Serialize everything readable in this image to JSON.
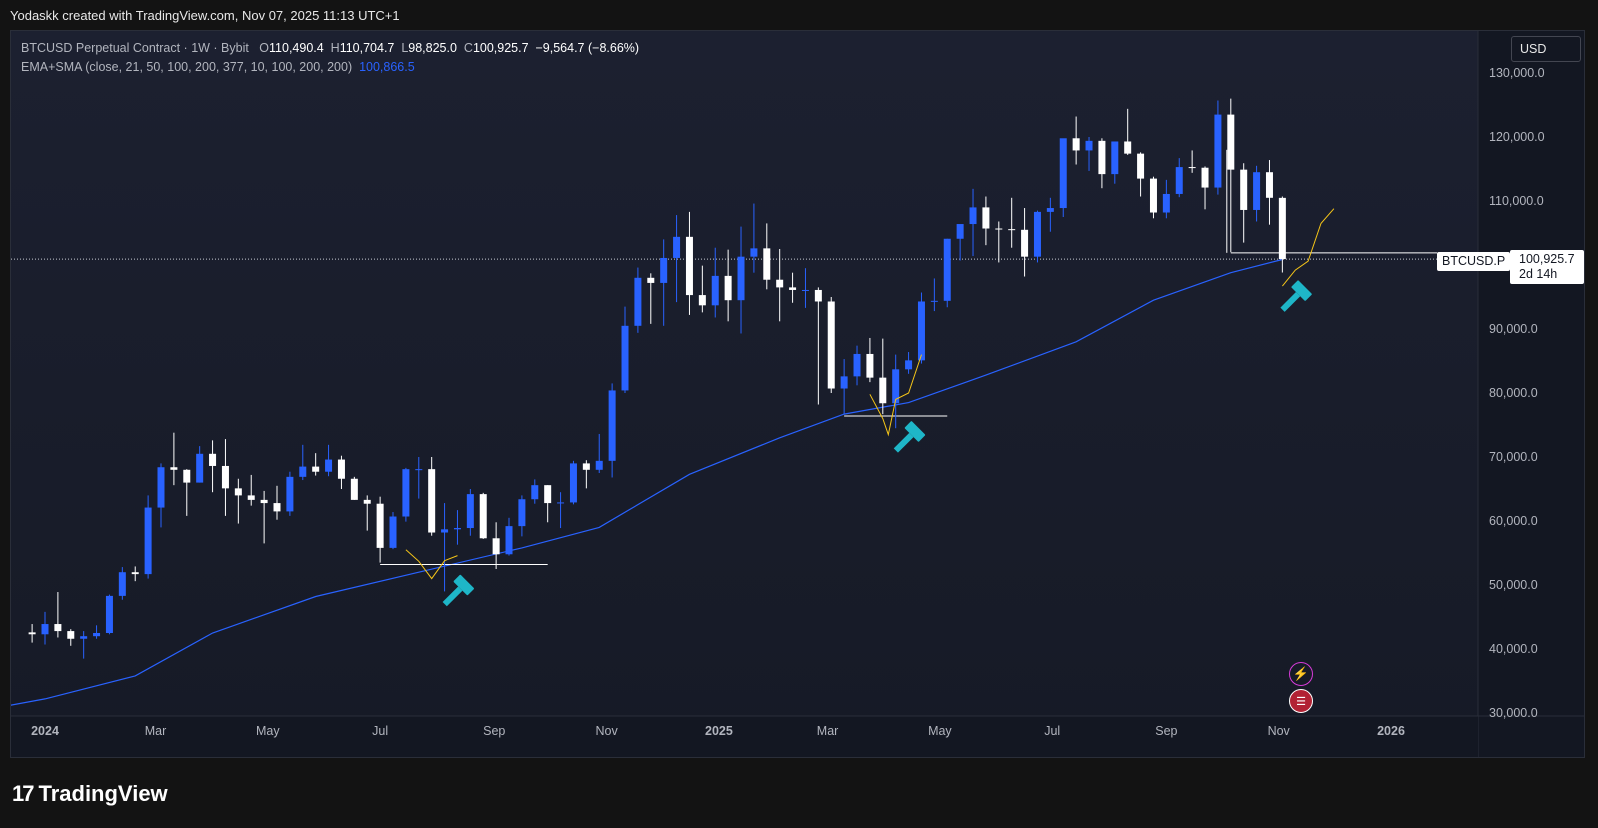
{
  "header": {
    "credit": "Yodaskk created with TradingView.com, Nov 07, 2025 11:13 UTC+1"
  },
  "legend": {
    "symbol": "BTCUSD Perpetual Contract · 1W · Bybit",
    "open_label": "O",
    "open": "110,490.4",
    "high_label": "H",
    "high": "110,704.7",
    "low_label": "L",
    "low": "98,825.0",
    "close_label": "C",
    "close": "100,925.7",
    "change": "−9,564.7 (−8.66%)",
    "indicator": "EMA+SMA (close, 21, 50, 100, 200, 377, 10, 100, 200, 200)",
    "indicator_value": "100,866.5"
  },
  "currency": "USD",
  "price_tag": {
    "ticker": "BTCUSD.P",
    "price": "100,925.7",
    "countdown": "2d 14h"
  },
  "footer": {
    "brand": "TradingView",
    "brand_mark": "17"
  },
  "colors": {
    "up_candle": "#2962ff",
    "down_candle": "#ffffff",
    "ema_line": "#2962ff",
    "projection": "#f5c518",
    "hammer_icon": "#1eb6c8",
    "background_top": "#1c2030",
    "background_bottom": "#161a26"
  },
  "icons": [
    "hammer-icon",
    "lightning-icon",
    "us-flag-icon"
  ],
  "chart_data": {
    "type": "candlestick",
    "interval": "1W",
    "ylim": [
      30000,
      130000
    ],
    "y_ticks": [
      "130,000.0",
      "120,000.0",
      "110,000.0",
      "100,000.0",
      "90,000.0",
      "80,000.0",
      "70,000.0",
      "60,000.0",
      "50,000.0",
      "40,000.0",
      "30,000.0"
    ],
    "y_tick_values": [
      130000,
      120000,
      110000,
      100000,
      90000,
      80000,
      70000,
      60000,
      50000,
      40000,
      30000
    ],
    "x_ticks": [
      "2024",
      "Mar",
      "May",
      "Jul",
      "Sep",
      "Nov",
      "2025",
      "Mar",
      "May",
      "Jul",
      "Sep",
      "Nov",
      "2026"
    ],
    "x_tick_dates": [
      "2024-01-01",
      "2024-03-01",
      "2024-05-01",
      "2024-07-01",
      "2024-09-01",
      "2024-11-01",
      "2025-01-01",
      "2025-03-01",
      "2025-05-01",
      "2025-07-01",
      "2025-09-01",
      "2025-11-01",
      "2026-01-01"
    ],
    "last_price": 100925.7,
    "candles": [
      {
        "d": "2023-12-25",
        "o": 42600,
        "h": 43900,
        "l": 41000,
        "c": 42300
      },
      {
        "d": "2024-01-01",
        "o": 42300,
        "h": 45800,
        "l": 40700,
        "c": 43900
      },
      {
        "d": "2024-01-08",
        "o": 43900,
        "h": 48900,
        "l": 41800,
        "c": 42800
      },
      {
        "d": "2024-01-15",
        "o": 42800,
        "h": 43100,
        "l": 40500,
        "c": 41600
      },
      {
        "d": "2024-01-22",
        "o": 41600,
        "h": 42800,
        "l": 38500,
        "c": 42000
      },
      {
        "d": "2024-01-29",
        "o": 42000,
        "h": 43700,
        "l": 41600,
        "c": 42500
      },
      {
        "d": "2024-02-05",
        "o": 42500,
        "h": 48500,
        "l": 42300,
        "c": 48300
      },
      {
        "d": "2024-02-12",
        "o": 48300,
        "h": 52800,
        "l": 47700,
        "c": 52000
      },
      {
        "d": "2024-02-19",
        "o": 52000,
        "h": 52900,
        "l": 50600,
        "c": 51700
      },
      {
        "d": "2024-02-26",
        "o": 51700,
        "h": 64000,
        "l": 51000,
        "c": 62100
      },
      {
        "d": "2024-03-04",
        "o": 62100,
        "h": 69000,
        "l": 59000,
        "c": 68400
      },
      {
        "d": "2024-03-11",
        "o": 68400,
        "h": 73800,
        "l": 65600,
        "c": 68000
      },
      {
        "d": "2024-03-18",
        "o": 68000,
        "h": 68100,
        "l": 60800,
        "c": 66000
      },
      {
        "d": "2024-03-25",
        "o": 66000,
        "h": 71700,
        "l": 66000,
        "c": 70500
      },
      {
        "d": "2024-04-01",
        "o": 70500,
        "h": 72600,
        "l": 64500,
        "c": 68600
      },
      {
        "d": "2024-04-08",
        "o": 68600,
        "h": 72800,
        "l": 60800,
        "c": 65100
      },
      {
        "d": "2024-04-15",
        "o": 65100,
        "h": 66600,
        "l": 59600,
        "c": 64000
      },
      {
        "d": "2024-04-22",
        "o": 64000,
        "h": 67200,
        "l": 62400,
        "c": 63300
      },
      {
        "d": "2024-04-29",
        "o": 63300,
        "h": 64700,
        "l": 56500,
        "c": 62800
      },
      {
        "d": "2024-05-06",
        "o": 62800,
        "h": 65500,
        "l": 60200,
        "c": 61500
      },
      {
        "d": "2024-05-13",
        "o": 61500,
        "h": 67700,
        "l": 60800,
        "c": 66900
      },
      {
        "d": "2024-05-20",
        "o": 66900,
        "h": 71900,
        "l": 66400,
        "c": 68500
      },
      {
        "d": "2024-05-27",
        "o": 68500,
        "h": 70600,
        "l": 67100,
        "c": 67700
      },
      {
        "d": "2024-06-03",
        "o": 67700,
        "h": 71900,
        "l": 67000,
        "c": 69600
      },
      {
        "d": "2024-06-10",
        "o": 69600,
        "h": 70200,
        "l": 65000,
        "c": 66600
      },
      {
        "d": "2024-06-17",
        "o": 66600,
        "h": 66900,
        "l": 63300,
        "c": 63300
      },
      {
        "d": "2024-06-24",
        "o": 63300,
        "h": 64000,
        "l": 58500,
        "c": 62700
      },
      {
        "d": "2024-07-01",
        "o": 62700,
        "h": 63800,
        "l": 53500,
        "c": 55800
      },
      {
        "d": "2024-07-08",
        "o": 55800,
        "h": 61400,
        "l": 55600,
        "c": 60700
      },
      {
        "d": "2024-07-15",
        "o": 60700,
        "h": 68300,
        "l": 59900,
        "c": 68100
      },
      {
        "d": "2024-07-22",
        "o": 68100,
        "h": 70000,
        "l": 63500,
        "c": 68100
      },
      {
        "d": "2024-07-29",
        "o": 68100,
        "h": 70000,
        "l": 57700,
        "c": 58200
      },
      {
        "d": "2024-08-05",
        "o": 58200,
        "h": 62800,
        "l": 49000,
        "c": 58700
      },
      {
        "d": "2024-08-12",
        "o": 58700,
        "h": 61700,
        "l": 56300,
        "c": 58900
      },
      {
        "d": "2024-08-19",
        "o": 58900,
        "h": 65000,
        "l": 57700,
        "c": 64200
      },
      {
        "d": "2024-08-26",
        "o": 64200,
        "h": 64400,
        "l": 57200,
        "c": 57300
      },
      {
        "d": "2024-09-02",
        "o": 57300,
        "h": 59800,
        "l": 52500,
        "c": 54800
      },
      {
        "d": "2024-09-09",
        "o": 54800,
        "h": 60500,
        "l": 54600,
        "c": 59200
      },
      {
        "d": "2024-09-16",
        "o": 59200,
        "h": 64000,
        "l": 57600,
        "c": 63400
      },
      {
        "d": "2024-09-23",
        "o": 63400,
        "h": 66500,
        "l": 62700,
        "c": 65600
      },
      {
        "d": "2024-09-30",
        "o": 65600,
        "h": 65600,
        "l": 59800,
        "c": 62800
      },
      {
        "d": "2024-10-07",
        "o": 62800,
        "h": 64500,
        "l": 58900,
        "c": 62900
      },
      {
        "d": "2024-10-14",
        "o": 62900,
        "h": 69400,
        "l": 62600,
        "c": 69000
      },
      {
        "d": "2024-10-21",
        "o": 69000,
        "h": 69500,
        "l": 65100,
        "c": 68000
      },
      {
        "d": "2024-10-28",
        "o": 68000,
        "h": 73600,
        "l": 67500,
        "c": 69400
      },
      {
        "d": "2024-11-04",
        "o": 69400,
        "h": 81500,
        "l": 66800,
        "c": 80400
      },
      {
        "d": "2024-11-11",
        "o": 80400,
        "h": 93500,
        "l": 80000,
        "c": 90500
      },
      {
        "d": "2024-11-18",
        "o": 90500,
        "h": 99600,
        "l": 89400,
        "c": 98000
      },
      {
        "d": "2024-11-25",
        "o": 98000,
        "h": 98700,
        "l": 90800,
        "c": 97200
      },
      {
        "d": "2024-12-02",
        "o": 97200,
        "h": 104000,
        "l": 90500,
        "c": 101100
      },
      {
        "d": "2024-12-09",
        "o": 101100,
        "h": 107800,
        "l": 94200,
        "c": 104400
      },
      {
        "d": "2024-12-16",
        "o": 104400,
        "h": 108300,
        "l": 92200,
        "c": 95300
      },
      {
        "d": "2024-12-23",
        "o": 95300,
        "h": 99900,
        "l": 92600,
        "c": 93700
      },
      {
        "d": "2024-12-30",
        "o": 93700,
        "h": 102700,
        "l": 91800,
        "c": 98300
      },
      {
        "d": "2025-01-06",
        "o": 98300,
        "h": 102400,
        "l": 91200,
        "c": 94500
      },
      {
        "d": "2025-01-13",
        "o": 94500,
        "h": 106000,
        "l": 89300,
        "c": 101300
      },
      {
        "d": "2025-01-20",
        "o": 101300,
        "h": 109600,
        "l": 98800,
        "c": 102600
      },
      {
        "d": "2025-01-27",
        "o": 102600,
        "h": 106500,
        "l": 96200,
        "c": 97700
      },
      {
        "d": "2025-02-03",
        "o": 97700,
        "h": 102500,
        "l": 91200,
        "c": 96500
      },
      {
        "d": "2025-02-10",
        "o": 96500,
        "h": 98800,
        "l": 94100,
        "c": 96100
      },
      {
        "d": "2025-02-17",
        "o": 96100,
        "h": 99500,
        "l": 93300,
        "c": 96100
      },
      {
        "d": "2025-02-24",
        "o": 96100,
        "h": 96500,
        "l": 78200,
        "c": 94300
      },
      {
        "d": "2025-03-03",
        "o": 94300,
        "h": 95000,
        "l": 80000,
        "c": 80700
      },
      {
        "d": "2025-03-10",
        "o": 80700,
        "h": 85300,
        "l": 76700,
        "c": 82600
      },
      {
        "d": "2025-03-17",
        "o": 82600,
        "h": 87400,
        "l": 81200,
        "c": 86100
      },
      {
        "d": "2025-03-24",
        "o": 86100,
        "h": 88600,
        "l": 81700,
        "c": 82400
      },
      {
        "d": "2025-03-31",
        "o": 82400,
        "h": 88500,
        "l": 76700,
        "c": 78400
      },
      {
        "d": "2025-04-07",
        "o": 78400,
        "h": 86000,
        "l": 74500,
        "c": 83700
      },
      {
        "d": "2025-04-14",
        "o": 83700,
        "h": 86400,
        "l": 83000,
        "c": 85100
      },
      {
        "d": "2025-04-21",
        "o": 85100,
        "h": 95700,
        "l": 84600,
        "c": 94300
      },
      {
        "d": "2025-04-28",
        "o": 94300,
        "h": 97900,
        "l": 92800,
        "c": 94400
      },
      {
        "d": "2025-05-05",
        "o": 94400,
        "h": 104100,
        "l": 93400,
        "c": 104100
      },
      {
        "d": "2025-05-12",
        "o": 104100,
        "h": 106100,
        "l": 100700,
        "c": 106400
      },
      {
        "d": "2025-05-19",
        "o": 106400,
        "h": 111900,
        "l": 101400,
        "c": 109000
      },
      {
        "d": "2025-05-26",
        "o": 109000,
        "h": 110700,
        "l": 103100,
        "c": 105700
      },
      {
        "d": "2025-06-02",
        "o": 105700,
        "h": 106800,
        "l": 100400,
        "c": 105600
      },
      {
        "d": "2025-06-09",
        "o": 105600,
        "h": 110500,
        "l": 102700,
        "c": 105500
      },
      {
        "d": "2025-06-16",
        "o": 105500,
        "h": 108900,
        "l": 98200,
        "c": 101300
      },
      {
        "d": "2025-06-23",
        "o": 101300,
        "h": 108500,
        "l": 100400,
        "c": 108300
      },
      {
        "d": "2025-06-30",
        "o": 108300,
        "h": 110500,
        "l": 105200,
        "c": 108900
      },
      {
        "d": "2025-07-07",
        "o": 108900,
        "h": 119500,
        "l": 107500,
        "c": 119800
      },
      {
        "d": "2025-07-14",
        "o": 119800,
        "h": 123200,
        "l": 115700,
        "c": 117900
      },
      {
        "d": "2025-07-21",
        "o": 117900,
        "h": 120000,
        "l": 114700,
        "c": 119400
      },
      {
        "d": "2025-07-28",
        "o": 119400,
        "h": 119800,
        "l": 112000,
        "c": 114200
      },
      {
        "d": "2025-08-04",
        "o": 114200,
        "h": 119300,
        "l": 112700,
        "c": 119300
      },
      {
        "d": "2025-08-11",
        "o": 119300,
        "h": 124400,
        "l": 117200,
        "c": 117400
      },
      {
        "d": "2025-08-18",
        "o": 117400,
        "h": 117600,
        "l": 110700,
        "c": 113500
      },
      {
        "d": "2025-08-25",
        "o": 113500,
        "h": 113800,
        "l": 107300,
        "c": 108200
      },
      {
        "d": "2025-09-01",
        "o": 108200,
        "h": 113300,
        "l": 107300,
        "c": 111100
      },
      {
        "d": "2025-09-08",
        "o": 111100,
        "h": 116700,
        "l": 110600,
        "c": 115300
      },
      {
        "d": "2025-09-15",
        "o": 115300,
        "h": 117900,
        "l": 114400,
        "c": 115200
      },
      {
        "d": "2025-09-22",
        "o": 115200,
        "h": 115400,
        "l": 108700,
        "c": 112100
      },
      {
        "d": "2025-09-29",
        "o": 112100,
        "h": 125700,
        "l": 111000,
        "c": 123500
      },
      {
        "d": "2025-10-06",
        "o": 123500,
        "h": 126000,
        "l": 102000,
        "c": 114900
      },
      {
        "d": "2025-10-13",
        "o": 114900,
        "h": 115900,
        "l": 103500,
        "c": 108600
      },
      {
        "d": "2025-10-20",
        "o": 108600,
        "h": 115500,
        "l": 106800,
        "c": 114500
      },
      {
        "d": "2025-10-27",
        "o": 114500,
        "h": 116400,
        "l": 106300,
        "c": 110500
      },
      {
        "d": "2025-11-03",
        "o": 110490.4,
        "h": 110704.7,
        "l": 98825.0,
        "c": 100925.7
      }
    ],
    "ema": [
      {
        "d": "2023-11-20",
        "v": 30000
      },
      {
        "d": "2024-01-01",
        "v": 32200
      },
      {
        "d": "2024-02-19",
        "v": 35800
      },
      {
        "d": "2024-04-01",
        "v": 42500
      },
      {
        "d": "2024-05-27",
        "v": 48200
      },
      {
        "d": "2024-07-22",
        "v": 52000
      },
      {
        "d": "2024-09-16",
        "v": 55800
      },
      {
        "d": "2024-10-28",
        "v": 59000
      },
      {
        "d": "2024-12-16",
        "v": 67300
      },
      {
        "d": "2025-02-03",
        "v": 73000
      },
      {
        "d": "2025-03-10",
        "v": 76700
      },
      {
        "d": "2025-04-14",
        "v": 78500
      },
      {
        "d": "2025-05-26",
        "v": 82800
      },
      {
        "d": "2025-07-14",
        "v": 88000
      },
      {
        "d": "2025-08-25",
        "v": 94500
      },
      {
        "d": "2025-10-06",
        "v": 98800
      },
      {
        "d": "2025-11-03",
        "v": 100866.5
      }
    ],
    "projections": [
      [
        {
          "d": "2024-07-15",
          "v": 55500
        },
        {
          "d": "2024-07-22",
          "v": 53700
        },
        {
          "d": "2024-07-29",
          "v": 51000
        },
        {
          "d": "2024-08-05",
          "v": 53800
        },
        {
          "d": "2024-08-12",
          "v": 54600
        }
      ],
      [
        {
          "d": "2025-03-24",
          "v": 79800
        },
        {
          "d": "2025-03-31",
          "v": 76000
        },
        {
          "d": "2025-04-03",
          "v": 73500
        },
        {
          "d": "2025-04-07",
          "v": 79000
        },
        {
          "d": "2025-04-14",
          "v": 80000
        },
        {
          "d": "2025-04-21",
          "v": 86000
        }
      ],
      [
        {
          "d": "2025-11-03",
          "v": 96700
        },
        {
          "d": "2025-11-10",
          "v": 99200
        },
        {
          "d": "2025-11-17",
          "v": 100600
        },
        {
          "d": "2025-11-24",
          "v": 106500
        },
        {
          "d": "2025-12-01",
          "v": 108800
        }
      ]
    ],
    "support_lines": [
      {
        "d1": "2024-07-01",
        "d2": "2024-09-30",
        "v": 53200
      },
      {
        "d1": "2025-03-10",
        "d2": "2025-05-05",
        "v": 76400
      },
      {
        "d1": "2025-10-06",
        "d2": "2026-01-26",
        "v": 101900
      }
    ],
    "hammer_markers": [
      {
        "d": "2024-08-12",
        "v": 49000
      },
      {
        "d": "2025-04-14",
        "v": 73000
      },
      {
        "d": "2025-11-10",
        "v": 95000
      }
    ]
  }
}
